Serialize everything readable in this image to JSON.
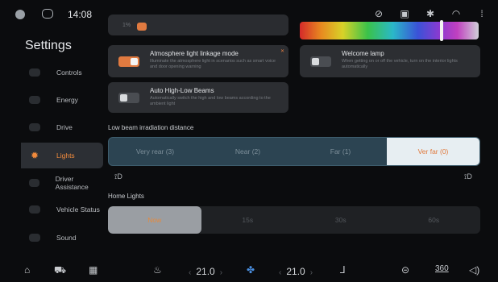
{
  "status": {
    "time": "14:08",
    "icons": [
      "steering-off-icon",
      "screen-icon",
      "bluetooth-icon",
      "wifi-icon",
      "signal-icon"
    ]
  },
  "sidebar": {
    "title": "Settings",
    "items": [
      {
        "label": "Controls",
        "icon": "controls-icon",
        "active": false
      },
      {
        "label": "Energy",
        "icon": "energy-icon",
        "active": false
      },
      {
        "label": "Drive",
        "icon": "drive-icon",
        "active": false
      },
      {
        "label": "Lights",
        "icon": "sun-icon",
        "active": true
      },
      {
        "label": "Driver Assistance",
        "icon": "assist-icon",
        "active": false
      },
      {
        "label": "Vehicle Status",
        "icon": "status-icon",
        "active": false
      },
      {
        "label": "Sound",
        "icon": "sound-icon",
        "active": false
      }
    ]
  },
  "lights": {
    "top_small_label": "1%",
    "atmosphere": {
      "title": "Atmosphere light linkage mode",
      "desc": "Illuminate the atmosphere light in scenarios such as smart voice and door opening warning",
      "on": true
    },
    "welcome": {
      "title": "Welcome lamp",
      "desc": "When getting on or off the vehicle, turn on the interior lights automatically",
      "on": false
    },
    "auto_beams": {
      "title": "Auto High-Low Beams",
      "desc": "Automatically switch the high and low beams according to the ambient light",
      "on": false
    },
    "low_beam_label": "Low beam irradiation distance",
    "low_beam_options": [
      "Very rear (3)",
      "Near (2)",
      "Far (1)",
      "Ver far (0)"
    ],
    "low_beam_selected": 3,
    "beam_icon_left": "⟟D",
    "beam_icon_right": "⟟D",
    "home_label": "Home Lights",
    "home_options": [
      "Now",
      "15s",
      "30s",
      "60s"
    ],
    "home_selected": 0
  },
  "bottom": {
    "temp_left": "21.0",
    "temp_right": "21.0",
    "camera360": "360"
  },
  "colors": {
    "accent": "#e07a40",
    "beam_selected_bg": "#e7eef2"
  }
}
